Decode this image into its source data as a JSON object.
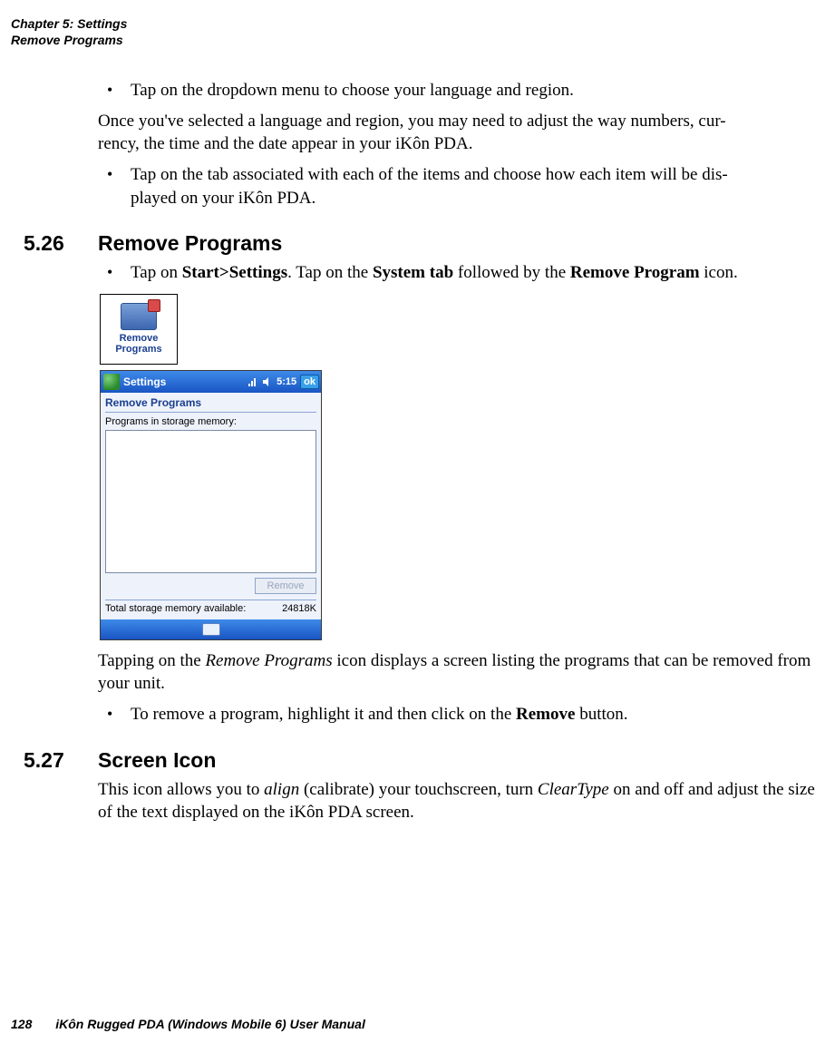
{
  "header": {
    "chapter_line": "Chapter 5: Settings",
    "section_line": "Remove Programs"
  },
  "intro": {
    "bullet1": "Tap on the dropdown menu to choose your language and region.",
    "para1a": "Once you've selected a language and region, you may need to adjust the way numbers, cur-",
    "para1b": "rency, the time and the date appear in your iKôn PDA.",
    "bullet2a": "Tap on the tab associated with each of the items and choose how each item will be dis-",
    "bullet2b": "played on your iKôn PDA."
  },
  "sec526": {
    "num": "5.26",
    "title": "Remove Programs",
    "bullet_pre": "Tap on ",
    "bullet_b1": "Start>Settings",
    "bullet_mid1": ". Tap on the ",
    "bullet_b2": "System tab",
    "bullet_mid2": " followed by the ",
    "bullet_b3": "Remove Program",
    "bullet_post": " icon.",
    "icon_caption1": "Remove",
    "icon_caption2": "Programs",
    "after_para_a": "Tapping on the ",
    "after_para_em": "Remove Programs",
    "after_para_b": " icon displays a screen listing the programs that can be removed from your unit.",
    "remove_bullet_a": "To remove a program, highlight it and then click on the ",
    "remove_bullet_b": "Remove",
    "remove_bullet_c": " button."
  },
  "pda": {
    "title": "Settings",
    "time": "5:15",
    "ok": "ok",
    "heading": "Remove Programs",
    "label": "Programs in storage memory:",
    "remove_btn": "Remove",
    "mem_label": "Total storage memory available:",
    "mem_value": "24818K"
  },
  "sec527": {
    "num": "5.27",
    "title": "Screen Icon",
    "p_a": "This icon allows you to ",
    "p_em1": "align",
    "p_b": " (calibrate) your touchscreen, turn ",
    "p_em2": "ClearType",
    "p_c": " on and off and adjust the size of the text displayed on the iKôn PDA screen."
  },
  "footer": {
    "page": "128",
    "book": "iKôn Rugged PDA (Windows Mobile 6) User Manual"
  }
}
